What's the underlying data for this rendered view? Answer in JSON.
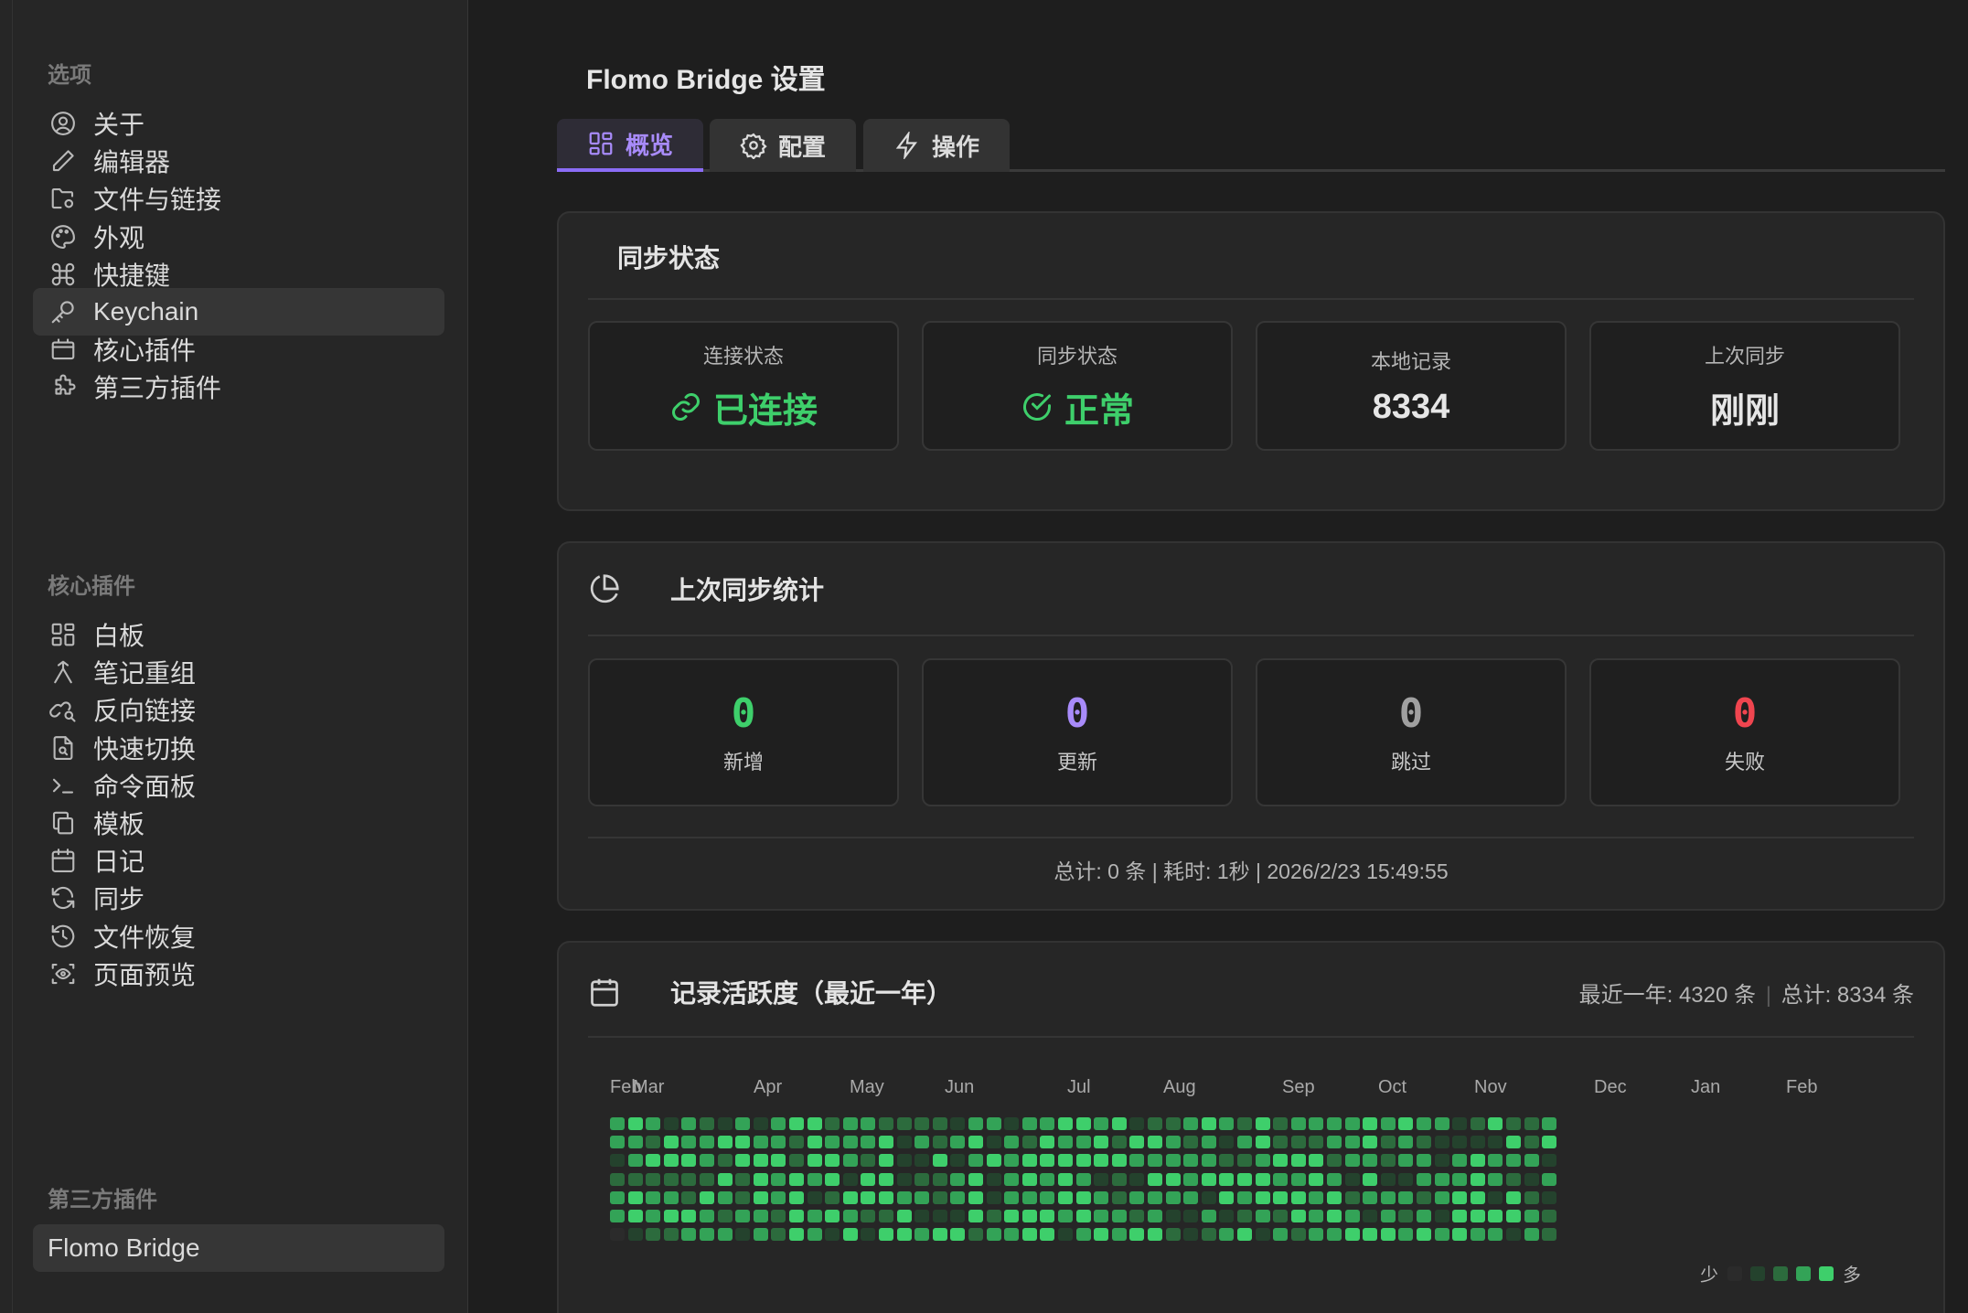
{
  "sidebar": {
    "options_title": "选项",
    "options": [
      {
        "label": "关于",
        "icon": "user-circle-icon"
      },
      {
        "label": "编辑器",
        "icon": "pen-icon"
      },
      {
        "label": "文件与链接",
        "icon": "folder-cog-icon"
      },
      {
        "label": "外观",
        "icon": "palette-icon"
      },
      {
        "label": "快捷键",
        "icon": "command-icon"
      },
      {
        "label": "Keychain",
        "icon": "key-icon",
        "active": true
      },
      {
        "label": "核心插件",
        "icon": "plugin-box-icon"
      },
      {
        "label": "第三方插件",
        "icon": "puzzle-icon"
      }
    ],
    "core_title": "核心插件",
    "core": [
      {
        "label": "白板",
        "icon": "layout-grid-icon"
      },
      {
        "label": "笔记重组",
        "icon": "merge-icon"
      },
      {
        "label": "反向链接",
        "icon": "link-search-icon"
      },
      {
        "label": "快速切换",
        "icon": "file-search-icon"
      },
      {
        "label": "命令面板",
        "icon": "terminal-icon"
      },
      {
        "label": "模板",
        "icon": "copy-icon"
      },
      {
        "label": "日记",
        "icon": "calendar-icon"
      },
      {
        "label": "同步",
        "icon": "refresh-icon"
      },
      {
        "label": "文件恢复",
        "icon": "history-icon"
      },
      {
        "label": "页面预览",
        "icon": "preview-eye-icon"
      }
    ],
    "third_title": "第三方插件",
    "third": [
      {
        "label": "Flomo Bridge",
        "active": true
      }
    ]
  },
  "header": {
    "title": "Flomo Bridge 设置"
  },
  "tabs": [
    {
      "label": "概览",
      "icon": "grid-icon",
      "active": true
    },
    {
      "label": "配置",
      "icon": "gear-icon"
    },
    {
      "label": "操作",
      "icon": "bolt-icon"
    }
  ],
  "sync_status": {
    "title": "同步状态",
    "items": [
      {
        "label": "连接状态",
        "value": "已连接",
        "icon": "link-icon",
        "color": "#3ecf6b"
      },
      {
        "label": "同步状态",
        "value": "正常",
        "icon": "check-circle-icon",
        "color": "#3ecf6b"
      },
      {
        "label": "本地记录",
        "value": "8334",
        "color": "#e6e6e6"
      },
      {
        "label": "上次同步",
        "value": "刚刚",
        "color": "#e6e6e6"
      }
    ]
  },
  "last_sync": {
    "title": "上次同步统计",
    "icon": "pie-chart-icon",
    "items": [
      {
        "label": "新增",
        "value": "0",
        "color": "#3ecf6b"
      },
      {
        "label": "更新",
        "value": "0",
        "color": "#a88bfa"
      },
      {
        "label": "跳过",
        "value": "0",
        "color": "#a0a0a0"
      },
      {
        "label": "失败",
        "value": "0",
        "color": "#f0454f"
      }
    ],
    "summary": "总计: 0 条 | 耗时: 1秒 | 2026/2/23 15:49:55"
  },
  "activity": {
    "title": "记录活跃度（最近一年）",
    "icon": "calendar-icon",
    "stats_year": "最近一年: 4320 条",
    "stats_sep": "|",
    "stats_total": "总计: 8334 条",
    "months": [
      "Feb",
      "Mar",
      "Apr",
      "May",
      "Jun",
      "Jul",
      "Aug",
      "Sep",
      "Oct",
      "Nov",
      "Dec",
      "Jan",
      "Feb"
    ],
    "legend_less": "少",
    "legend_more": "多",
    "palette": [
      "#2b2b2b",
      "#24422d",
      "#2c6b3d",
      "#33a357",
      "#3ecf6b"
    ]
  }
}
